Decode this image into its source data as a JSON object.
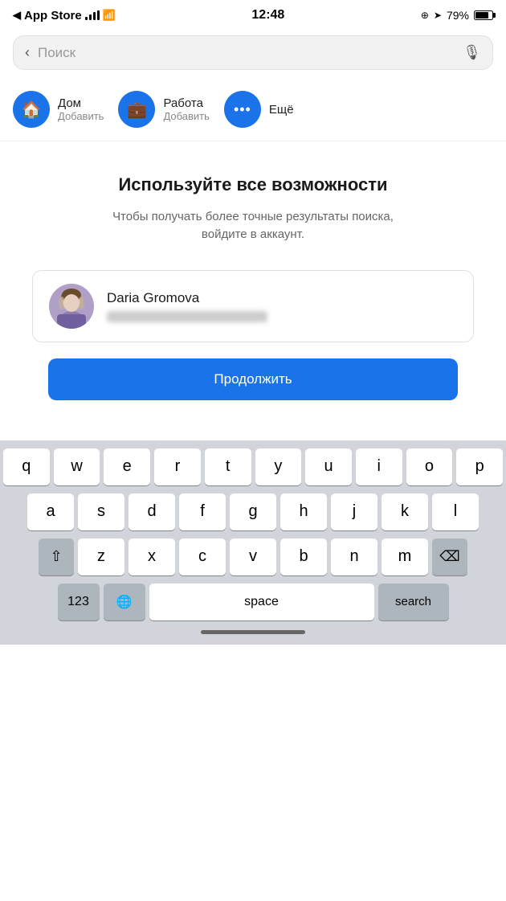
{
  "statusBar": {
    "carrier": "App Store",
    "time": "12:48",
    "battery": "79%",
    "batteryPercent": 79
  },
  "searchBar": {
    "placeholder": "Поиск",
    "backLabel": "‹"
  },
  "quickActions": [
    {
      "id": "home",
      "icon": "🏠",
      "title": "Дом",
      "subtitle": "Добавить"
    },
    {
      "id": "work",
      "icon": "💼",
      "title": "Работа",
      "subtitle": "Добавить"
    },
    {
      "id": "more",
      "icon": "•••",
      "title": "Ещё"
    }
  ],
  "mainContent": {
    "title": "Используйте все возможности",
    "subtitle": "Чтобы получать более точные результаты поиска,\nвойдите в аккаунт."
  },
  "userCard": {
    "name": "Daria Gromova",
    "emailBlurred": true
  },
  "continueButton": {
    "label": "Продолжить"
  },
  "keyboard": {
    "rows": [
      [
        "q",
        "w",
        "e",
        "r",
        "t",
        "y",
        "u",
        "i",
        "o",
        "p"
      ],
      [
        "a",
        "s",
        "d",
        "f",
        "g",
        "h",
        "j",
        "k",
        "l"
      ],
      [
        "z",
        "x",
        "c",
        "v",
        "b",
        "n",
        "m"
      ]
    ],
    "spaceLabel": "space",
    "searchLabel": "search",
    "numLabel": "123",
    "deleteSymbol": "⌫",
    "shiftSymbol": "⇧"
  }
}
